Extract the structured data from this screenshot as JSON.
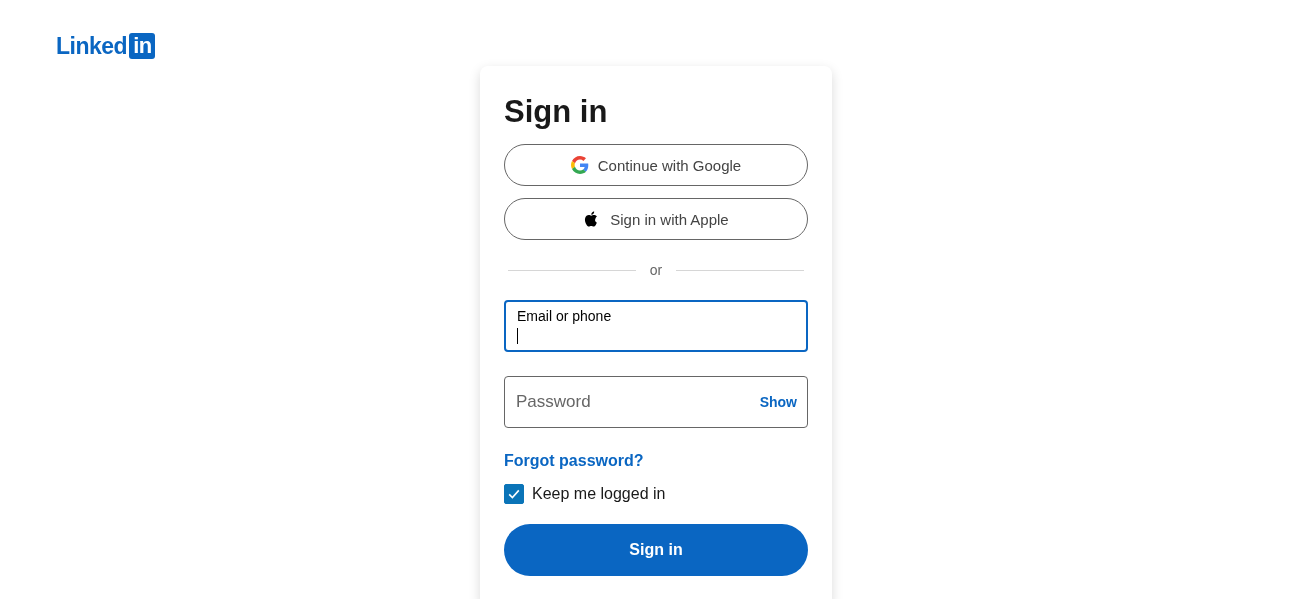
{
  "logo": {
    "text": "Linked",
    "badge": "in"
  },
  "card": {
    "title": "Sign in",
    "providers": [
      {
        "kind": "google",
        "label": "Continue with Google"
      },
      {
        "kind": "apple",
        "label": "Sign in with Apple"
      }
    ],
    "divider": "or",
    "fields": [
      {
        "kind": "email",
        "label": "Email or phone",
        "focused": true
      },
      {
        "kind": "password",
        "placeholder": "Password",
        "toggle": "Show",
        "focused": false
      }
    ],
    "forgot_link": "Forgot password?",
    "remember": {
      "label": "Keep me logged in",
      "checked": true
    },
    "submit": "Sign in"
  }
}
